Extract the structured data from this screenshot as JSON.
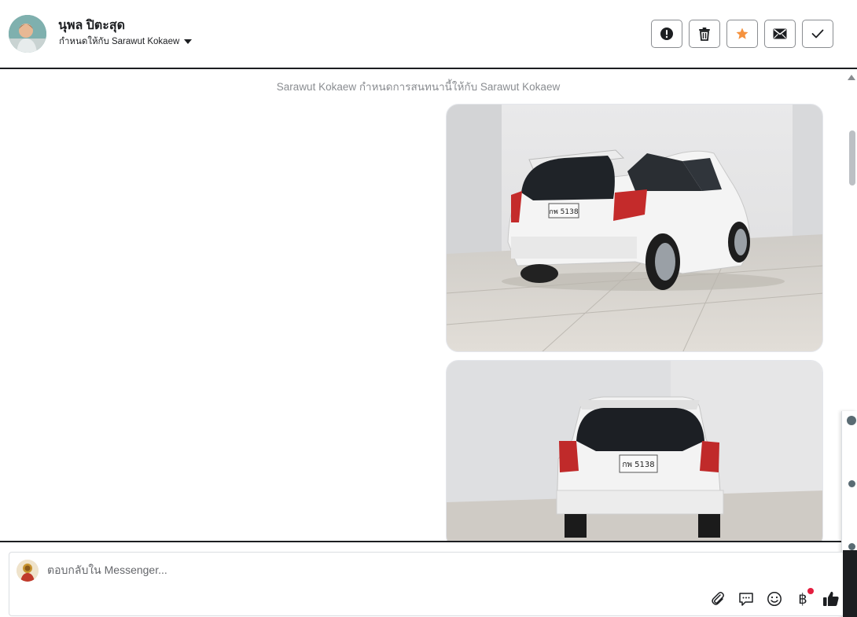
{
  "header": {
    "name": "นุพล ปิตะสุด",
    "assigned_to": "กำหนดให้กับ Sarawut Kokaew"
  },
  "conversation": {
    "system_message": "Sarawut Kokaew กำหนดการสนทนานี้ให้กับ Sarawut Kokaew",
    "plate_text": "กพ 5138"
  },
  "composer": {
    "placeholder": "ตอบกลับใน Messenger..."
  },
  "colors": {
    "star": "#f5923e",
    "red_dot": "#e41e3f",
    "border": "#1c1e21"
  },
  "icons": {
    "actions": [
      "alert-icon",
      "trash-icon",
      "star-icon",
      "mail-icon",
      "check-icon"
    ],
    "tools": [
      "attach-icon",
      "chat-icon",
      "emoji-icon",
      "baht-icon",
      "like-icon"
    ]
  }
}
